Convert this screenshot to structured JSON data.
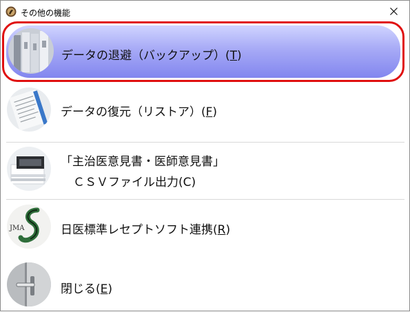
{
  "window": {
    "title": "その他の機能",
    "app_icon": "app-logo-icon",
    "close_icon": "close-icon"
  },
  "menu": {
    "items": [
      {
        "label": "データの退避（バックアップ）(",
        "key": "T",
        "suffix": ")",
        "icon": "binders-icon",
        "selected": true
      },
      {
        "label": "データの復元（リストア）(",
        "key": "F",
        "suffix": ")",
        "icon": "documents-icon",
        "selected": false
      },
      {
        "label": "「主治医意見書・医師意見書」",
        "label2": "ＣＳＶファイル出力(C)",
        "icon": "paper-stack-icon",
        "selected": false
      },
      {
        "label": "日医標準レセプトソフト連携(",
        "key": "R",
        "suffix": ")",
        "icon": "jma-logo-icon",
        "selected": false
      },
      {
        "label": "閉じる(",
        "key": "E",
        "suffix": ")",
        "icon": "door-handle-icon",
        "selected": false
      }
    ]
  },
  "colors": {
    "selected_border": "#e01010",
    "selected_gradient_top": "#d0d4ff",
    "selected_gradient_bottom": "#8286ef"
  }
}
